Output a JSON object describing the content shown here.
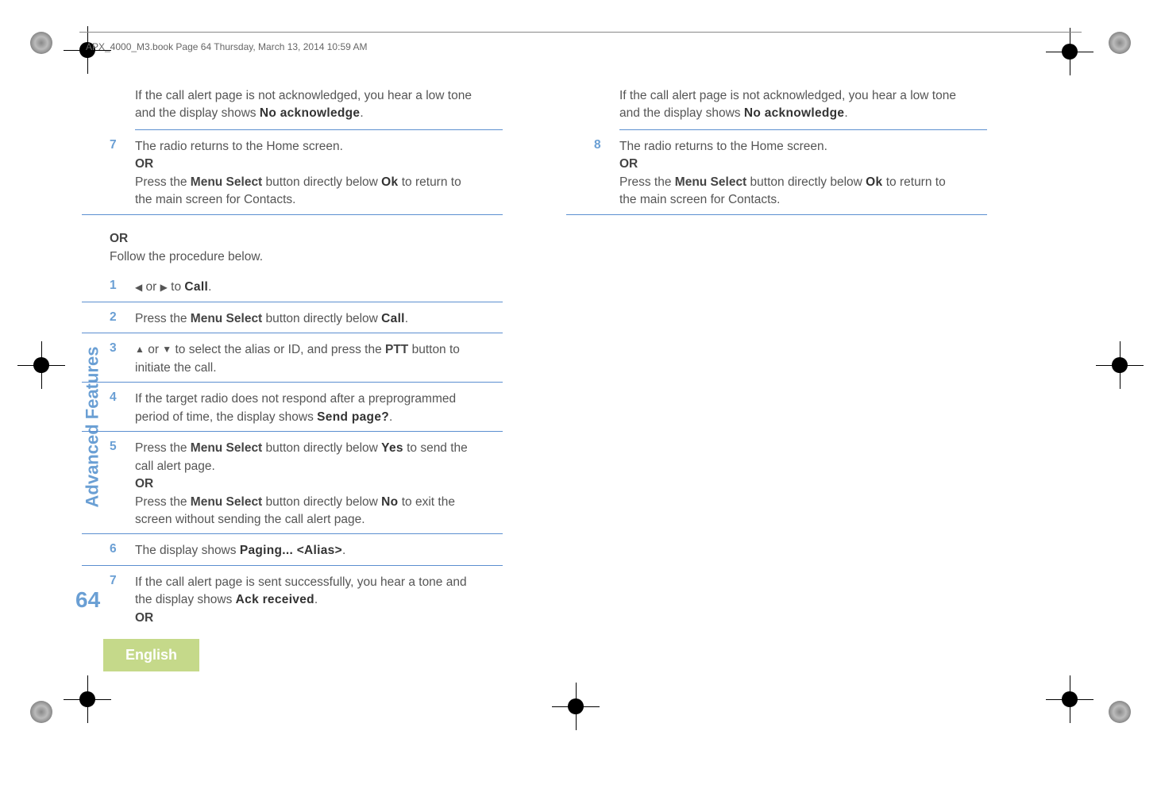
{
  "header": "APX_4000_M3.book  Page 64  Thursday, March 13, 2014  10:59 AM",
  "sidebar_label": "Advanced Features",
  "page_number": "64",
  "language": "English",
  "left_column": {
    "continuation_text_1": "If the call alert page is not acknowledged, you hear a low tone and the display shows ",
    "continuation_display": "No acknowledge",
    "continuation_text_2": ".",
    "step7": {
      "num": "7",
      "line1": "The radio returns to the Home screen.",
      "or": "OR",
      "line2a": "Press the ",
      "line2_bold": "Menu Select",
      "line2b": " button directly below ",
      "line2_display": "Ok",
      "line2c": " to return to the main screen for Contacts."
    },
    "or_section": {
      "or": "OR",
      "text": "Follow the procedure below."
    },
    "step1": {
      "num": "1",
      "arrow_left": "◀",
      "or": " or ",
      "arrow_right": "▶",
      "to": " to ",
      "display": "Call",
      "period": "."
    },
    "step2": {
      "num": "2",
      "text1": "Press the ",
      "bold": "Menu Select",
      "text2": " button directly below ",
      "display": "Call",
      "period": "."
    },
    "step3": {
      "num": "3",
      "arrow_up": "▲",
      "or": " or ",
      "arrow_down": "▼",
      "text1": " to select the alias or ID, and press the ",
      "bold": "PTT",
      "text2": " button to initiate the call."
    },
    "step4": {
      "num": "4",
      "text1": "If the target radio does not respond after a preprogrammed period of time, the display shows ",
      "display": "Send page?",
      "period": "."
    },
    "step5": {
      "num": "5",
      "text1": "Press the ",
      "bold1": "Menu Select",
      "text2": " button directly below ",
      "display1": "Yes",
      "text3": " to send the call alert page.",
      "or": "OR",
      "text4": "Press the ",
      "bold2": "Menu Select",
      "text5": " button directly below ",
      "display2": "No",
      "text6": " to exit the screen without sending the call alert page."
    },
    "step6": {
      "num": "6",
      "text1": "The display shows ",
      "display": "Paging... <Alias>",
      "period": "."
    },
    "step7b": {
      "num": "7",
      "text1": "If the call alert page is sent successfully, you hear a tone and the display shows ",
      "display": "Ack received",
      "period": ".",
      "or": "OR"
    }
  },
  "right_column": {
    "continuation_text_1": "If the call alert page is not acknowledged, you hear a low tone and the display shows ",
    "continuation_display": "No acknowledge",
    "continuation_text_2": ".",
    "step8": {
      "num": "8",
      "line1": "The radio returns to the Home screen.",
      "or": "OR",
      "line2a": "Press the ",
      "line2_bold": "Menu Select",
      "line2b": " button directly below ",
      "line2_display": "Ok",
      "line2c": " to return to the main screen for Contacts."
    }
  }
}
